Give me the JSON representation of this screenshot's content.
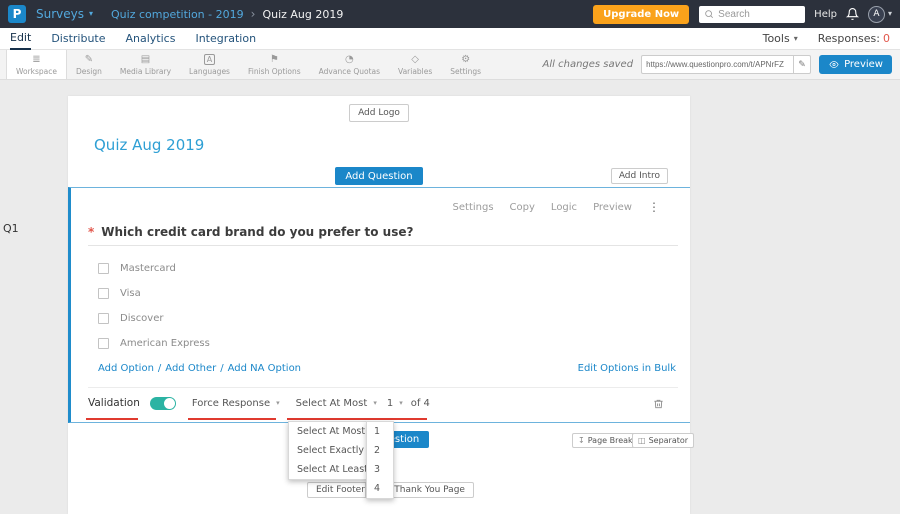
{
  "colors": {
    "accent": "#1b87c9",
    "topbar": "#2c313c",
    "upgrade_orange": "#faa21b",
    "toggle_on": "#2bb3a3",
    "annotation_red": "#e03a2f"
  },
  "icons": {
    "caret": "▾",
    "chevron": "›",
    "dots": "⋮",
    "pencil": "✎",
    "star": "*",
    "slash": "/",
    "page_break": "↧",
    "separator": "◫"
  },
  "topbar": {
    "logo_letter": "P",
    "product": "Surveys",
    "crumb_parent": "Quiz competition - 2019",
    "crumb_current": "Quiz Aug 2019",
    "upgrade": "Upgrade Now",
    "search_placeholder": "Search",
    "help": "Help",
    "avatar": "A"
  },
  "nav": {
    "items": [
      "Edit",
      "Distribute",
      "Analytics",
      "Integration"
    ],
    "tools": "Tools",
    "responses": "Responses:",
    "responses_count": "0"
  },
  "toolbar": {
    "items": [
      {
        "icon": "≣",
        "label": "Workspace"
      },
      {
        "icon": "✎",
        "label": "Design"
      },
      {
        "icon": "▤",
        "label": "Media Library"
      },
      {
        "icon": "A",
        "label": "Languages"
      },
      {
        "icon": "⚑",
        "label": "Finish Options"
      },
      {
        "icon": "◔",
        "label": "Advance Quotas"
      },
      {
        "icon": "◇",
        "label": "Variables"
      },
      {
        "icon": "⚙",
        "label": "Settings"
      }
    ],
    "saved": "All changes saved",
    "url": "https://www.questionpro.com/t/APNrFZ",
    "preview": "Preview"
  },
  "canvas": {
    "q_label": "Q1",
    "add_logo": "Add Logo",
    "title": "Quiz Aug 2019",
    "add_question": "Add Question",
    "add_intro": "Add Intro",
    "page_break": "Page Break",
    "separator": "Separator",
    "edit_footer": "Edit Footer",
    "edit_thank_you": "Edit Thank You Page"
  },
  "question": {
    "actions": [
      "Settings",
      "Copy",
      "Logic",
      "Preview"
    ],
    "text": "Which credit card brand do you prefer to use?",
    "options": [
      "Mastercard",
      "Visa",
      "Discover",
      "American Express"
    ],
    "links": [
      "Add Option",
      "Add Other",
      "Add NA Option"
    ],
    "bulk": "Edit Options in Bulk",
    "validation": "Validation",
    "force_response": "Force Response",
    "rule": "Select At Most",
    "count": "1",
    "of": "of 4"
  },
  "dropdowns": {
    "rules": [
      "Select At Most",
      "Select Exactly",
      "Select At Least"
    ],
    "counts": [
      "1",
      "2",
      "3",
      "4"
    ]
  }
}
